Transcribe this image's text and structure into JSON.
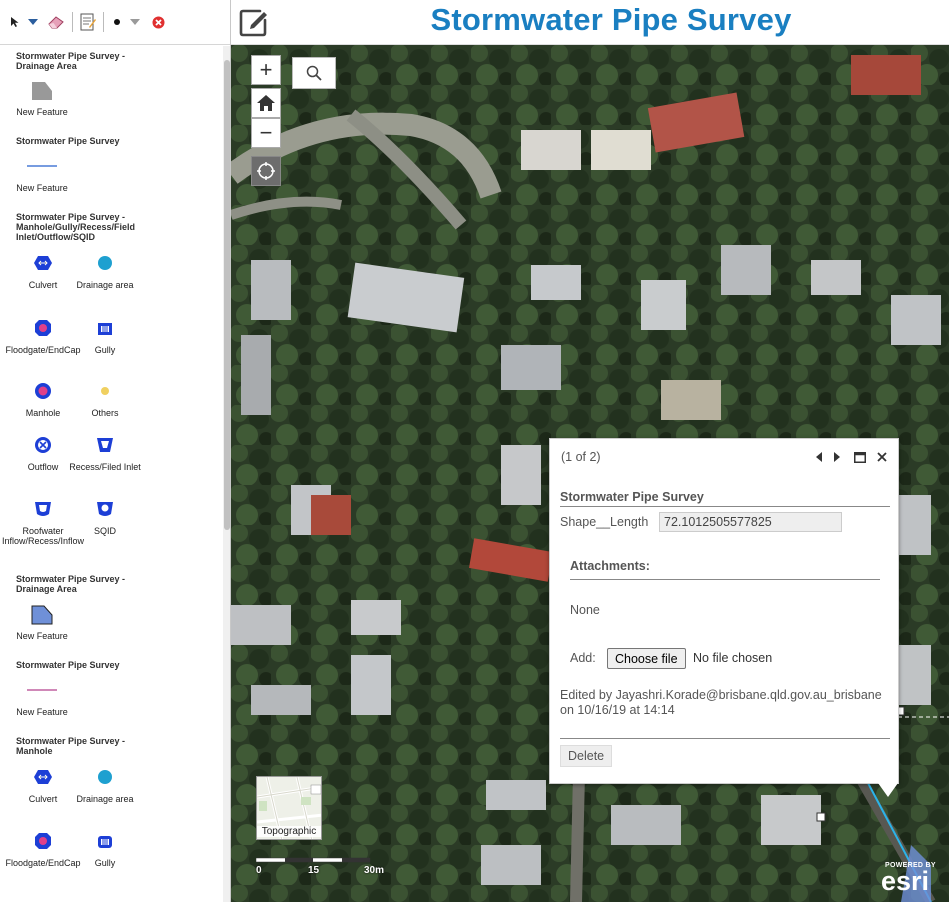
{
  "header": {
    "title": "Stormwater Pipe Survey"
  },
  "templates": {
    "groups": [
      {
        "title": "Stormwater Pipe Survey - Drainage Area",
        "items": [
          {
            "label": "New Feature",
            "symbol": "gray-polygon"
          }
        ]
      },
      {
        "title": "Stormwater Pipe Survey",
        "items": [
          {
            "label": "New Feature",
            "symbol": "blue-line"
          }
        ]
      },
      {
        "title": "Stormwater Pipe Survey - Manhole/Gully/Recess/Field Inlet/Outflow/SQID",
        "items": [
          {
            "label": "Culvert",
            "symbol": "culvert-icon"
          },
          {
            "label": "Drainage area",
            "symbol": "drainage-area-icon"
          },
          {
            "label": "Floodgate/EndCap",
            "symbol": "floodgate-icon"
          },
          {
            "label": "Gully",
            "symbol": "gully-icon"
          },
          {
            "label": "Manhole",
            "symbol": "manhole-icon"
          },
          {
            "label": "Others",
            "symbol": "others-icon"
          },
          {
            "label": "Outflow",
            "symbol": "outflow-icon"
          },
          {
            "label": "Recess/Filed Inlet",
            "symbol": "recess-inlet-icon"
          },
          {
            "label": "Roofwater Inflow/Recess/Inflow",
            "symbol": "roofwater-icon"
          },
          {
            "label": "SQID",
            "symbol": "sqid-icon"
          }
        ]
      },
      {
        "title": "Stormwater Pipe Survey - Drainage Area",
        "items": [
          {
            "label": "New Feature",
            "symbol": "blue-polygon"
          }
        ]
      },
      {
        "title": "Stormwater Pipe Survey",
        "items": [
          {
            "label": "New Feature",
            "symbol": "pink-line"
          }
        ]
      },
      {
        "title": "Stormwater Pipe Survey - Manhole",
        "items": [
          {
            "label": "Culvert",
            "symbol": "culvert-icon"
          },
          {
            "label": "Drainage area",
            "symbol": "drainage-area-icon"
          },
          {
            "label": "Floodgate/EndCap",
            "symbol": "floodgate-icon"
          },
          {
            "label": "Gully",
            "symbol": "gully-icon"
          }
        ]
      }
    ]
  },
  "map": {
    "zoom_in": "+",
    "zoom_out": "−",
    "basemap_label": "Topographic",
    "scale": {
      "labels": [
        "0",
        "15",
        "30m"
      ]
    },
    "attribution": {
      "powered_by": "POWERED BY",
      "brand": "esri"
    }
  },
  "popup": {
    "count": "(1 of 2)",
    "layer_name": "Stormwater Pipe Survey",
    "field_label": "Shape__Length",
    "field_value": "72.1012505577825",
    "attachments_title": "Attachments:",
    "attachments_none": "None",
    "add_label": "Add:",
    "file_button": "Choose file",
    "file_status": "No file chosen",
    "edited_text": "Edited by Jayashri.Korade@brisbane.qld.gov.au_brisbane on 10/16/19 at 14:14",
    "delete_button": "Delete"
  },
  "colors": {
    "title": "#1a7fc1",
    "symbol_blue": "#1d3fd6",
    "symbol_cyan": "#1ea0d0",
    "symbol_pink": "#e0408a"
  }
}
